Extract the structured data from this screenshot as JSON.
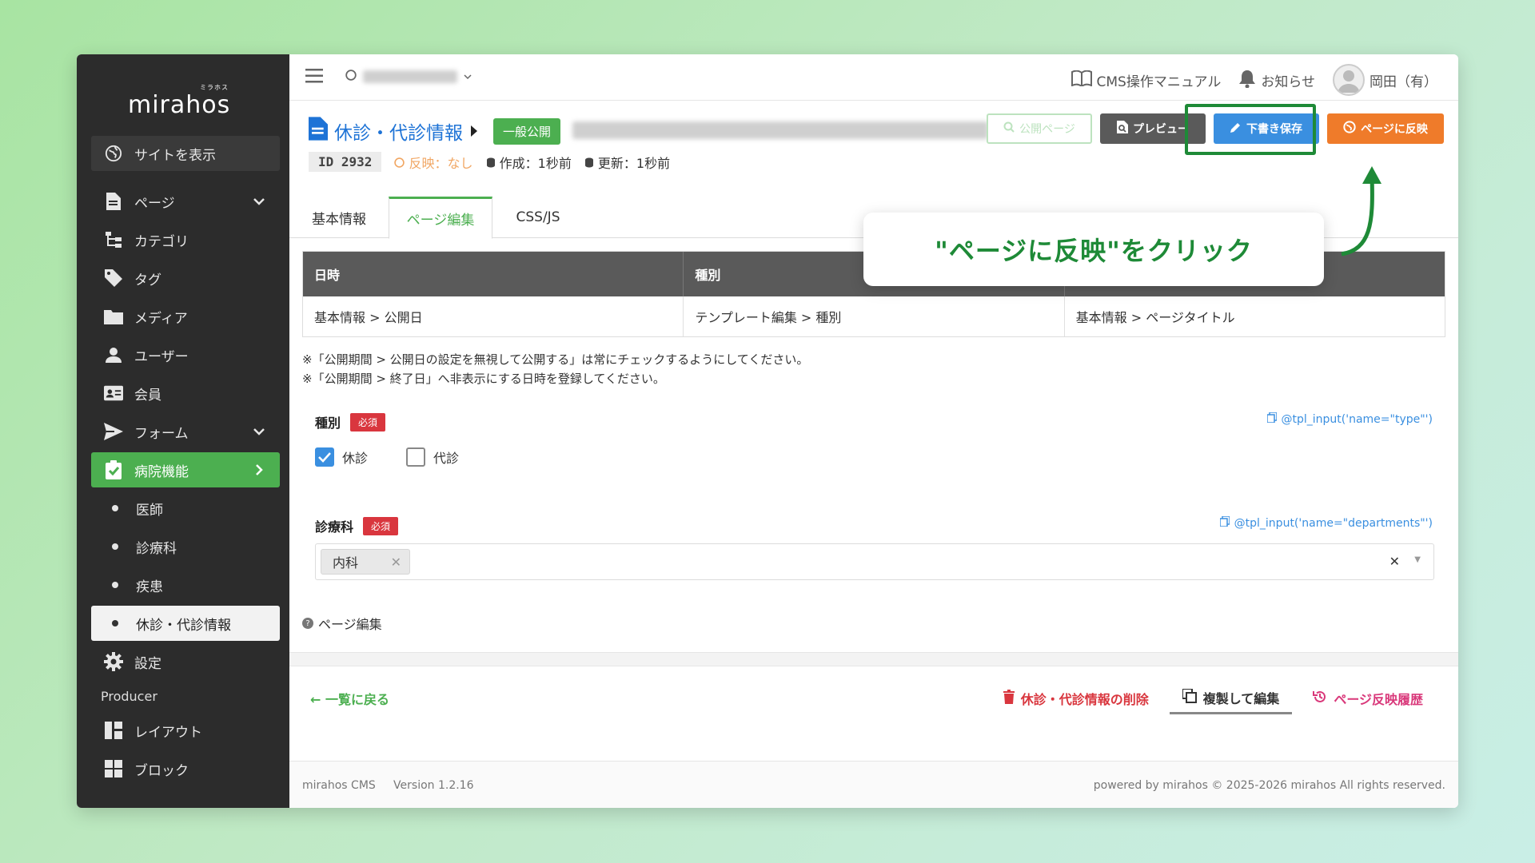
{
  "logo": {
    "text": "mirahos",
    "ruby": "ミラホス"
  },
  "sidebar": {
    "view_site": "サイトを表示",
    "items": [
      {
        "label": "ページ"
      },
      {
        "label": "カテゴリ"
      },
      {
        "label": "タグ"
      },
      {
        "label": "メディア"
      },
      {
        "label": "ユーザー"
      },
      {
        "label": "会員"
      },
      {
        "label": "フォーム"
      },
      {
        "label": "病院機能"
      }
    ],
    "sub_items": [
      {
        "label": "医師"
      },
      {
        "label": "診療科"
      },
      {
        "label": "疾患"
      },
      {
        "label": "休診・代診情報"
      }
    ],
    "settings": "設定",
    "section": "Producer",
    "producer_items": [
      {
        "label": "レイアウト"
      },
      {
        "label": "ブロック"
      }
    ]
  },
  "topbar": {
    "manual": "CMS操作マニュアル",
    "notice": "お知らせ",
    "user": "岡田（有）"
  },
  "page": {
    "title": "休診・代診情報",
    "status_badge": "一般公開",
    "id_label": "ID",
    "id_value": "2932",
    "reflect_status": "反映：なし",
    "created": "作成：1秒前",
    "updated": "更新：1秒前"
  },
  "buttons": {
    "public_page": "公開ページ",
    "preview": "プレビュー",
    "draft_save": "下書き保存",
    "reflect": "ページに反映"
  },
  "tabs": [
    "基本情報",
    "ページ編集",
    "CSS/JS"
  ],
  "table": {
    "headers": [
      "日時",
      "種別",
      ""
    ],
    "row": [
      "基本情報 > 公開日",
      "テンプレート編集 > 種別",
      "基本情報 > ページタイトル"
    ]
  },
  "notes": [
    "※「公開期間 > 公開日の設定を無視して公開する」は常にチェックするようにしてください。",
    "※「公開期間 > 終了日」へ非表示にする日時を登録してください。"
  ],
  "fields": {
    "type": {
      "label": "種別",
      "required": "必須",
      "tpl": "@tpl_input('name=\"type\"')",
      "options": [
        {
          "label": "休診",
          "checked": true
        },
        {
          "label": "代診",
          "checked": false
        }
      ]
    },
    "departments": {
      "label": "診療科",
      "required": "必須",
      "tpl": "@tpl_input('name=\"departments\"')",
      "selected": "内科"
    }
  },
  "help": "ページ編集",
  "bottom": {
    "back": "← 一覧に戻る",
    "delete": "休診・代診情報の削除",
    "duplicate": "複製して編集",
    "history": "ページ反映履歴"
  },
  "footer": {
    "left": "mirahos CMS     Version 1.2.16",
    "right": "powered by mirahos © 2025-2026 mirahos All rights reserved."
  },
  "callout": "\"ページに反映\"をクリック",
  "colors": {
    "sidebar_bg": "#2c2c2c",
    "accent_green": "#4caf50",
    "highlight_green": "#1e8a37",
    "reflect_orange": "#ef7b2a",
    "draft_blue": "#3a8fe0",
    "danger_red": "#d9363e"
  }
}
